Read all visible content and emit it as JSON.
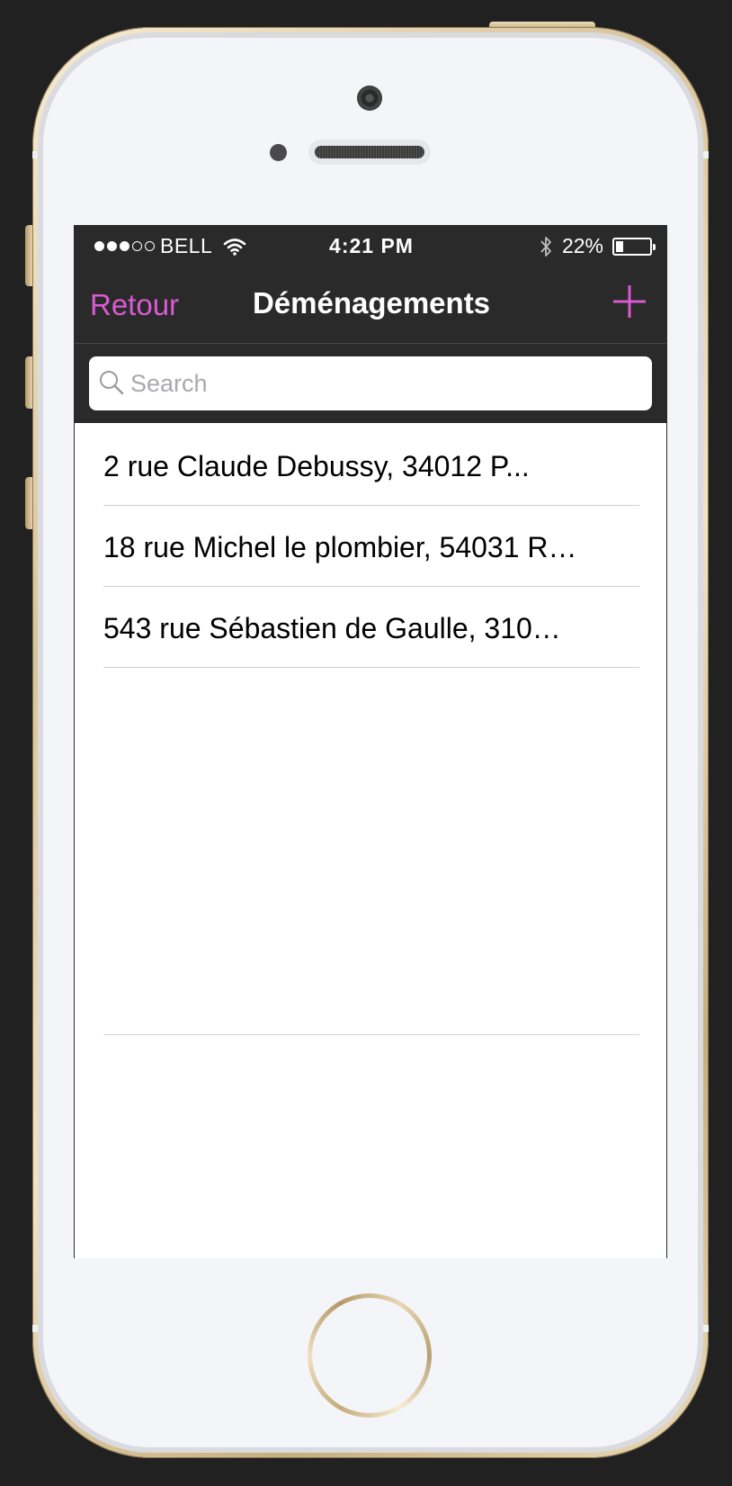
{
  "status_bar": {
    "signal_filled": 3,
    "signal_total": 5,
    "carrier": "BELL",
    "time": "4:21 PM",
    "battery_percent": "22%",
    "battery_level": 0.22,
    "icons": [
      "wifi-icon",
      "bluetooth-icon",
      "battery-icon"
    ]
  },
  "nav": {
    "back_label": "Retour",
    "title": "Déménagements",
    "add_icon": "plus-icon"
  },
  "search": {
    "placeholder": "Search",
    "value": "",
    "icon": "search-icon"
  },
  "list": {
    "items": [
      "2 rue Claude Debussy, 34012 P...",
      "18 rue Michel le plombier, 54031 R…",
      "543 rue Sébastien de Gaulle, 310…"
    ]
  },
  "colors": {
    "accent": "#d95ad3",
    "header_background": "#2a2a2a",
    "frame_gold": "#d9c49a"
  }
}
